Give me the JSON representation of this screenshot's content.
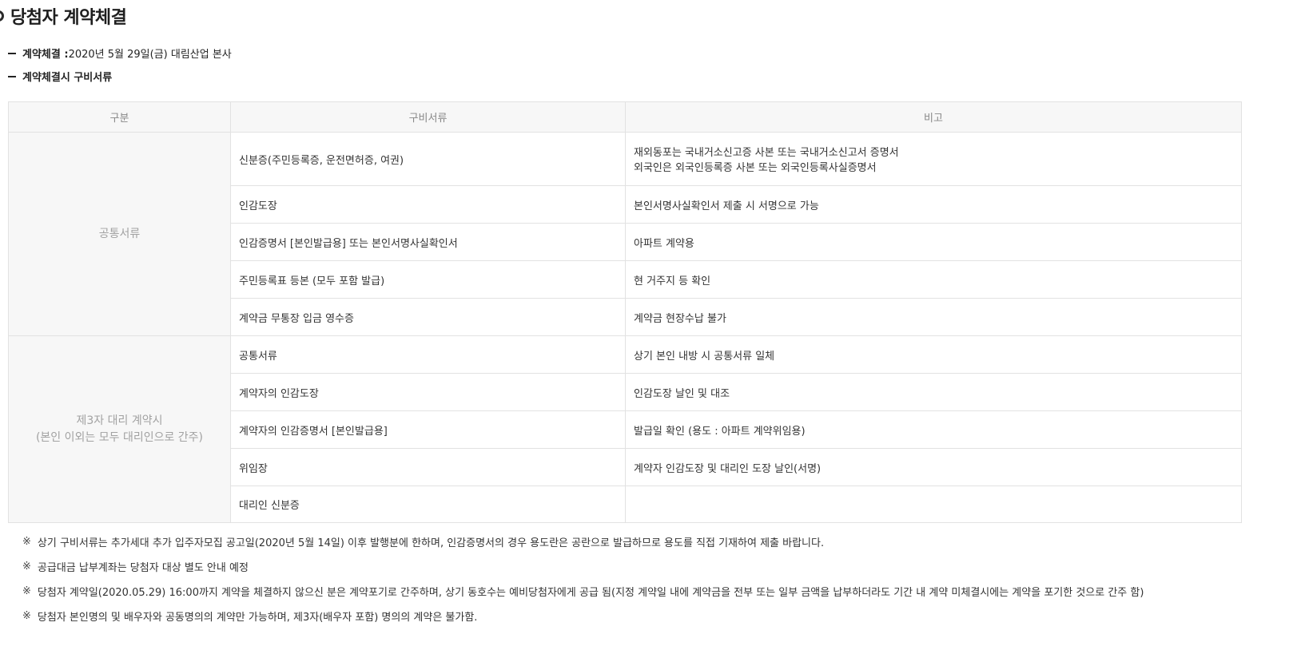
{
  "title": "당첨자 계약체결",
  "info": [
    {
      "label": "계약체결 :",
      "value": " 2020년 5월 29일(금) 대림산업 본사"
    },
    {
      "label": "계약체결시 구비서류",
      "value": ""
    }
  ],
  "table": {
    "headers": [
      "구분",
      "구비서류",
      "비고"
    ],
    "groups": [
      {
        "name_lines": [
          "공통서류"
        ],
        "rows": [
          {
            "doc": "신분증(주민등록증, 운전면허증, 여권)",
            "note_lines": [
              "재외동포는 국내거소신고증 사본 또는 국내거소신고서 증명서",
              "외국인은 외국인등록증 사본 또는 외국인등록사실증명서"
            ]
          },
          {
            "doc": "인감도장",
            "note_lines": [
              "본인서명사실확인서 제출 시 서명으로 가능"
            ]
          },
          {
            "doc": "인감증명서 [본인발급용] 또는 본인서명사실확인서",
            "note_lines": [
              "아파트 계약용"
            ]
          },
          {
            "doc": "주민등록표 등본 (모두 포함 발급)",
            "note_lines": [
              "현 거주지 등 확인"
            ]
          },
          {
            "doc": "계약금 무통장 입금 영수증",
            "note_lines": [
              "계약금 현장수납 불가"
            ]
          }
        ]
      },
      {
        "name_lines": [
          "제3자 대리 계약시",
          "(본인 이외는 모두 대리인으로 간주)"
        ],
        "rows": [
          {
            "doc": "공통서류",
            "note_lines": [
              "상기 본인 내방 시 공통서류 일체"
            ]
          },
          {
            "doc": "계약자의 인감도장",
            "note_lines": [
              "인감도장 날인 및 대조"
            ]
          },
          {
            "doc": "계약자의 인감증명서 [본인발급용]",
            "note_lines": [
              "발급일 확인 (용도 : 아파트 계약위임용)"
            ]
          },
          {
            "doc": "위임장",
            "note_lines": [
              "계약자 인감도장 및 대리인 도장 날인(서명)"
            ]
          },
          {
            "doc": "대리인 신분증",
            "note_lines": []
          }
        ]
      }
    ]
  },
  "notes": {
    "mark": "※",
    "items": [
      "상기 구비서류는 추가세대 추가 입주자모집 공고일(2020년 5월 14일) 이후 발행분에 한하며, 인감증명서의 경우 용도란은 공란으로 발급하므로 용도를 직접 기재하여 제출 바랍니다.",
      "공급대금 납부계좌는 당첨자 대상 별도 안내 예정",
      "당첨자 계약일(2020.05.29) 16:00까지 계약을 체결하지 않으신 분은 계약포기로 간주하며, 상기 동호수는 예비당첨자에게 공급 됨(지정 계약일 내에 계약금을 전부 또는 일부 금액을 납부하더라도 기간 내 계약 미체결시에는 계약을 포기한 것으로 간주 함)",
      "당첨자 본인명의 및 배우자와 공동명의의 계약만 가능하며, 제3자(배우자 포함) 명의의 계약은 불가함."
    ]
  }
}
